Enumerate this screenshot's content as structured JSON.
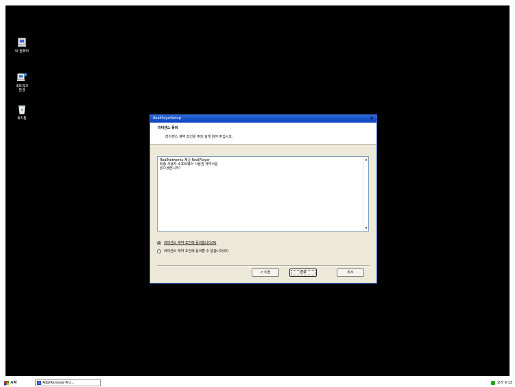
{
  "desktop": {
    "icons": [
      {
        "label": "내 컴퓨터",
        "icon": "my-computer-icon"
      },
      {
        "label": "네트워크\n환경",
        "icon": "network-icon"
      },
      {
        "label": "휴지통",
        "icon": "recycle-bin-icon"
      }
    ],
    "faint_text": "........"
  },
  "dialog": {
    "title": "RealPlayerSetup",
    "close_label": "✕",
    "header_title": "라이센스 동의",
    "header_subtitle": "라이센스 계약 조건을 주의 깊게 읽어 주십시오.",
    "license_text": "RealNetworks 제공 RealPlayer\n최종 사용자 소프트웨어 사용권 계약서를\n읽으셨습니까?",
    "accept_label": "라이센스 계약 조건에 동의합니다(A)",
    "decline_label": "라이센스 계약 조건에 동의할 수 없습니다(D)",
    "back_label": "< 이전",
    "next_label": "완료",
    "cancel_label": "취소"
  },
  "taskbar": {
    "start_label": "시작",
    "task_label": "Add/Remove Pro...",
    "clock": "오전 9:13"
  },
  "colors": {
    "desktop": "#000000",
    "titlebar": "#0a3fba",
    "dialog_face": "#ece9d8"
  }
}
